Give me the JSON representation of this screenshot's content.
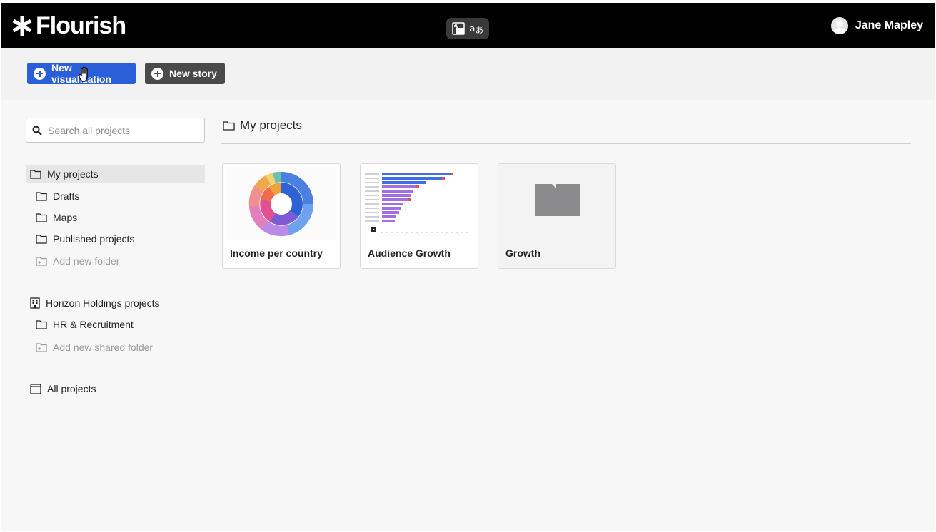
{
  "app": {
    "logo_text": "Flourish",
    "user_name": "Jane Mapley",
    "accent_color": "#2a5fd9"
  },
  "toolbar": {
    "new_visualization_label": "New visualization",
    "new_story_label": "New story"
  },
  "sidebar": {
    "search_placeholder": "Search all projects",
    "my_projects_label": "My projects",
    "folders": [
      "Drafts",
      "Maps",
      "Published projects"
    ],
    "add_folder_label": "Add new folder",
    "team_label": "Horizon Holdings projects",
    "team_folders": [
      "HR & Recruitment"
    ],
    "add_shared_folder_label": "Add new shared folder",
    "all_projects_label": "All projects"
  },
  "main": {
    "section_title": "My projects",
    "cards": [
      {
        "title": "Income per country",
        "kind": "sunburst"
      },
      {
        "title": "Audience Growth",
        "kind": "bar-chart-race"
      },
      {
        "title": "Growth",
        "kind": "folder"
      }
    ]
  }
}
